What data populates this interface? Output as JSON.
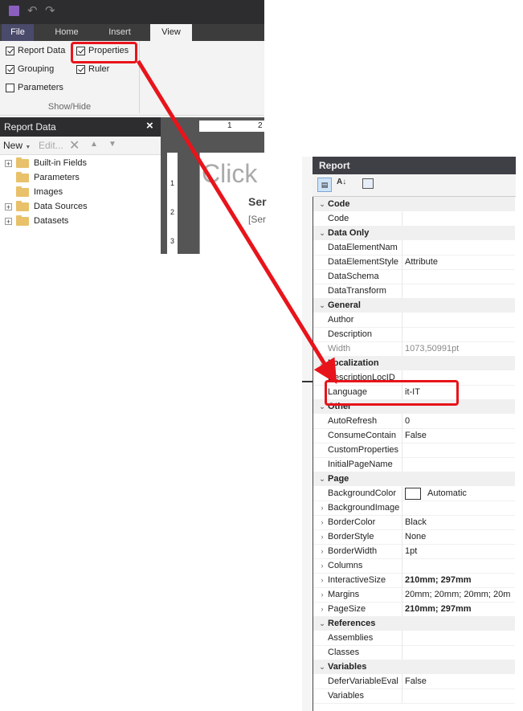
{
  "ribbon": {
    "tabs": [
      {
        "label": "File"
      },
      {
        "label": "Home"
      },
      {
        "label": "Insert"
      },
      {
        "label": "View"
      }
    ],
    "checkboxes": {
      "report_data": "Report Data",
      "properties": "Properties",
      "grouping": "Grouping",
      "ruler": "Ruler",
      "parameters": "Parameters"
    },
    "group_label": "Show/Hide"
  },
  "report_data": {
    "title": "Report Data",
    "toolbar": {
      "new": "New",
      "edit": "Edit..."
    },
    "tree": [
      {
        "label": "Built-in Fields"
      },
      {
        "label": "Parameters"
      },
      {
        "label": "Images"
      },
      {
        "label": "Data Sources"
      },
      {
        "label": "Datasets"
      }
    ]
  },
  "canvas": {
    "ruler_1": "1",
    "ruler_2": "2",
    "title_text": "Click",
    "header_text": "Ser",
    "field_text": "[Ser",
    "vruler": [
      "1",
      "2",
      "3"
    ]
  },
  "properties": {
    "title": "Report",
    "categories": {
      "code": "Code",
      "data_only": "Data Only",
      "general": "General",
      "localization": "Localization",
      "other": "Other",
      "page": "Page",
      "references": "References",
      "variables": "Variables"
    },
    "rows": {
      "code": {
        "name": "Code",
        "value": ""
      },
      "data_element_name": {
        "name": "DataElementNam",
        "value": ""
      },
      "data_element_style": {
        "name": "DataElementStyle",
        "value": "Attribute"
      },
      "data_schema": {
        "name": "DataSchema",
        "value": ""
      },
      "data_transform": {
        "name": "DataTransform",
        "value": ""
      },
      "author": {
        "name": "Author",
        "value": ""
      },
      "description": {
        "name": "Description",
        "value": ""
      },
      "width": {
        "name": "Width",
        "value": "1073,50991pt"
      },
      "description_locid": {
        "name": "DescriptionLocID",
        "value": ""
      },
      "language": {
        "name": "Language",
        "value": "it-IT"
      },
      "auto_refresh": {
        "name": "AutoRefresh",
        "value": "0"
      },
      "consume_container": {
        "name": "ConsumeContain",
        "value": "False"
      },
      "custom_properties": {
        "name": "CustomProperties",
        "value": ""
      },
      "initial_page_name": {
        "name": "InitialPageName",
        "value": ""
      },
      "background_color": {
        "name": "BackgroundColor",
        "value": "Automatic"
      },
      "background_image": {
        "name": "BackgroundImage",
        "value": ""
      },
      "border_color": {
        "name": "BorderColor",
        "value": "Black"
      },
      "border_style": {
        "name": "BorderStyle",
        "value": "None"
      },
      "border_width": {
        "name": "BorderWidth",
        "value": "1pt"
      },
      "columns": {
        "name": "Columns",
        "value": ""
      },
      "interactive_size": {
        "name": "InteractiveSize",
        "value": "210mm; 297mm"
      },
      "margins": {
        "name": "Margins",
        "value": "20mm; 20mm; 20mm; 20m"
      },
      "page_size": {
        "name": "PageSize",
        "value": "210mm; 297mm"
      },
      "assemblies": {
        "name": "Assemblies",
        "value": ""
      },
      "classes": {
        "name": "Classes",
        "value": ""
      },
      "defer_variable_eval": {
        "name": "DeferVariableEval",
        "value": "False"
      },
      "variables": {
        "name": "Variables",
        "value": ""
      }
    }
  },
  "colors": {
    "highlight": "#e8141b",
    "dark": "#2d2d30"
  }
}
